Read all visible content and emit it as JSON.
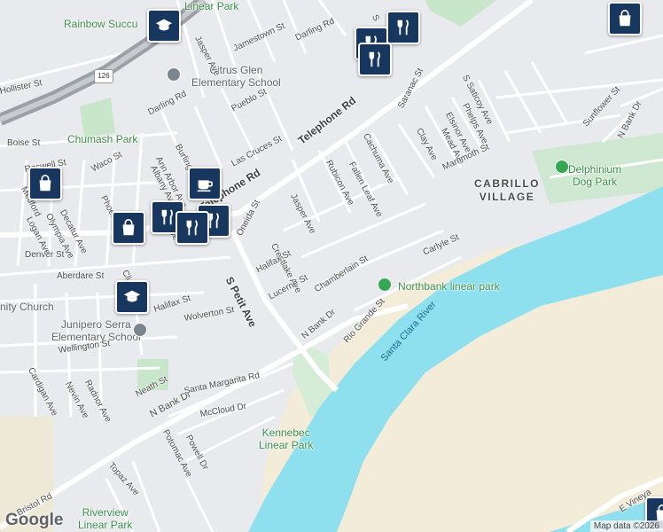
{
  "map": {
    "attribution": "Map data ©2026",
    "logo": "Google",
    "highway_shield": "126",
    "roads": {
      "telephone": "Telephone Rd",
      "s_petit": "S Petit Ave",
      "n_bank": "N Bank Dr",
      "n_bank_2": "N Bank Dr",
      "n_bank_3": "N Bank Dr",
      "denver": "Denver St",
      "e_vineyard": "E Vineya",
      "bristol": "Bristol Rd",
      "hollister": "Hollister St"
    },
    "streets": {
      "jasper_top": "Jasper Ave",
      "jamestown": "Jamestown St",
      "darling_top": "Darling Rd",
      "darling_left": "Darling Rd",
      "pueblo": "Pueblo St",
      "burlington": "Burlington Ave",
      "ann_arbor": "Ann Arbor Ave",
      "albany": "Albany Ave",
      "las_cruces": "Las Cruces St",
      "boise": "Boise St",
      "waco": "Waco St",
      "phoenix": "Phoenix",
      "roswell": "Roswell St",
      "medford": "Medford",
      "decatur": "Decatur Ave",
      "olympia": "Olympia Ave",
      "logan": "Logan Ave",
      "jasper_mid": "Jasper Ave",
      "rubicon": "Rubicon Ave",
      "fallen_leaf": "Fallen Leaf Ave",
      "cachuma": "Cachuma Ave",
      "saranac": "Saranac St",
      "clay": "Clay Ave",
      "mead": "Mead Ave",
      "elsinor": "Elsinor Ave",
      "phelps": "Phelps Ave",
      "s_saticoy": "S Saticoy Ave",
      "mammoth": "Mammoth St",
      "sunflower": "Sunflower St",
      "crestlake": "Crestlake Ave",
      "oneida": "Oneida St",
      "s_petit_small": "S Petit Ave",
      "halifax_right": "Halifax St",
      "halifax_left": "Halifax St",
      "lucerne": "Lucerne St",
      "chamberlain": "Chamberlain St",
      "carlyle": "Carlyle St",
      "rio_grande": "Rio Grande St",
      "aberdare": "Aberdare St",
      "clifton": "Cli",
      "wolverton": "Wolverton St",
      "wellington": "Wellington St",
      "cardigan": "Cardigan Ave",
      "nevin": "Nevin Ave",
      "radnor": "Radnor Ave",
      "neath": "Neath St",
      "santa_margarita": "Santa Margarita Rd",
      "mccloud": "McCloud Dr",
      "potomac": "Potomac Ave",
      "powell": "Powell Dr",
      "topaz": "Topaz Ave",
      "s_top": "S"
    },
    "parks": {
      "linear_park": "Linear Park",
      "chumash": "Chumash Park",
      "delphinium": "Delphinium\nDog Park",
      "northbank": "Northbank linear park",
      "kennebec": "Kennebec\nLinear Park",
      "riverview": "Riverview\nLinear Park"
    },
    "pois": {
      "rainbow": "Rainbow Succu",
      "citrus_glen": "Citrus Glen\nElementary School",
      "junipero": "Junipero Serra\nElementary School",
      "church": "nity Church"
    },
    "areas": {
      "cabrillo": "CABRILLO\nVILLAGE"
    },
    "water": {
      "santa_clara": "Santa Clara River"
    },
    "markers": [
      {
        "icon": "school-icon",
        "name": "school-marker-top"
      },
      {
        "icon": "shopping-bag-icon",
        "name": "shopping-marker-top-right"
      },
      {
        "icon": "restaurant-icon",
        "name": "restaurant-marker-top-a"
      },
      {
        "icon": "restaurant-icon",
        "name": "restaurant-marker-top-b"
      },
      {
        "icon": "restaurant-icon",
        "name": "restaurant-marker-top-c"
      },
      {
        "icon": "shopping-bag-icon",
        "name": "shopping-marker-left"
      },
      {
        "icon": "shopping-bag-icon",
        "name": "shopping-marker-denver"
      },
      {
        "icon": "coffee-icon",
        "name": "cafe-marker"
      },
      {
        "icon": "restaurant-icon",
        "name": "restaurant-marker-mid-a"
      },
      {
        "icon": "restaurant-icon",
        "name": "restaurant-marker-mid-b"
      },
      {
        "icon": "restaurant-icon",
        "name": "restaurant-marker-mid-c"
      },
      {
        "icon": "school-icon",
        "name": "school-marker-junipero"
      },
      {
        "icon": "shopping-bag-icon",
        "name": "shopping-marker-bottom-right"
      }
    ],
    "colors": {
      "water": "#8ee0ef",
      "park": "#c8e6c9",
      "sand": "#f3ecd9",
      "road": "#ffffff",
      "highway": "#9aa0a6",
      "marker": "#17375e"
    }
  }
}
